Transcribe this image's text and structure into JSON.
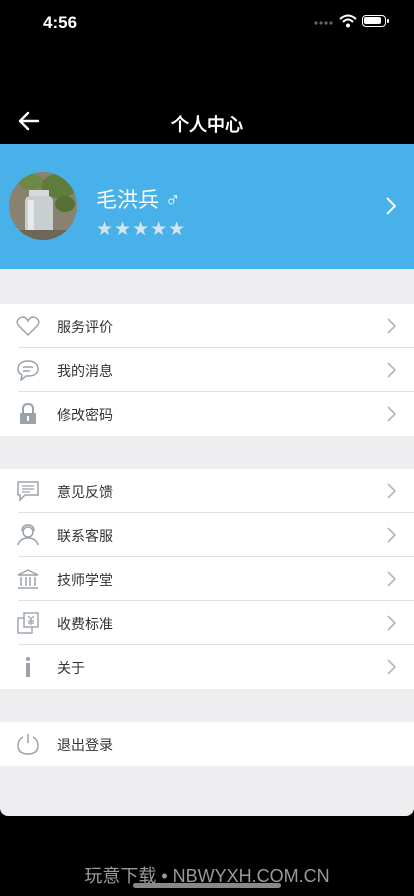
{
  "status_bar": {
    "time": "4:56"
  },
  "nav": {
    "title": "个人中心"
  },
  "profile": {
    "name": "毛洪兵 ♂",
    "rating_stars": "★★★★★",
    "rating": 5
  },
  "group1": [
    {
      "label": "服务评价",
      "icon": "heart-icon"
    },
    {
      "label": "我的消息",
      "icon": "message-bubble-icon"
    },
    {
      "label": "修改密码",
      "icon": "lock-icon"
    }
  ],
  "group2": [
    {
      "label": "意见反馈",
      "icon": "feedback-icon"
    },
    {
      "label": "联系客服",
      "icon": "customer-service-icon"
    },
    {
      "label": "技师学堂",
      "icon": "school-building-icon"
    },
    {
      "label": "收费标准",
      "icon": "price-tag-icon"
    },
    {
      "label": "关于",
      "icon": "info-icon"
    }
  ],
  "logout": {
    "label": "退出登录",
    "icon": "power-icon"
  },
  "watermark": "玩意下载 • NBWYXH.COM.CN",
  "colors": {
    "header_blue": "#49b1e9",
    "background": "#eeeef0"
  }
}
